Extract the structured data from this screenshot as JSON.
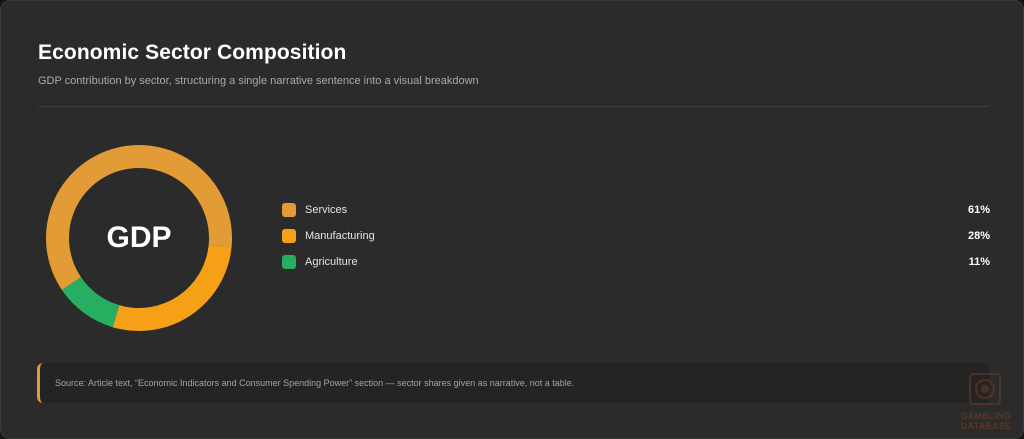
{
  "title": "Economic Sector Composition",
  "subtitle": "GDP contribution by sector, structuring a single narrative sentence into a visual breakdown",
  "source": "Source: Article text, “Economic Indicators and Consumer Spending Power” section — sector shares given as narrative, not a table.",
  "watermark": {
    "line1": "GAMBLING",
    "line2": "DATABASE",
    "icon": "chip-logo-icon"
  },
  "chart_data": {
    "type": "pie",
    "donut": true,
    "center_label": "GDP",
    "legend_placement": "right",
    "categories": [
      "Services",
      "Manufacturing",
      "Agriculture"
    ],
    "values": [
      61,
      28,
      11
    ],
    "labels": [
      "61%",
      "28%",
      "11%"
    ],
    "colors": [
      "#e39b35",
      "#f5a016",
      "#27ae60"
    ]
  }
}
